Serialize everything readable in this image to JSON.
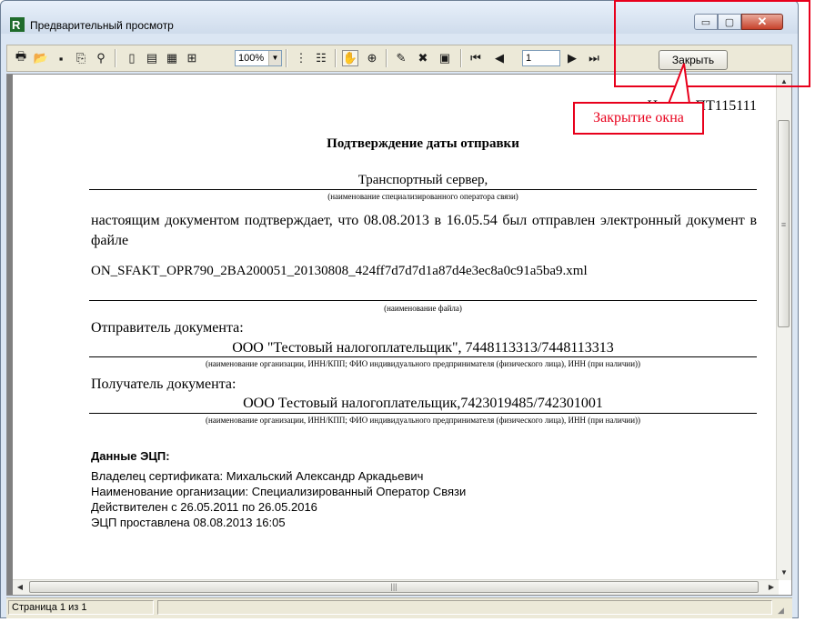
{
  "window": {
    "title": "Предварительный просмотр"
  },
  "window_controls": {
    "minimize": "▭",
    "maximize": "▢",
    "close": "✕"
  },
  "toolbar": {
    "zoom_value": "100%",
    "page_value": "1",
    "close_label": "Закрыть",
    "icons": [
      "print-icon",
      "open-icon",
      "save-icon",
      "export-icon",
      "find-icon",
      "page-view-icon",
      "page-width-icon",
      "two-pages-icon",
      "four-pages-icon",
      "outline-icon",
      "tree-icon",
      "hand-icon",
      "zoom-icon",
      "edit-icon",
      "delete-page-icon",
      "properties-icon",
      "first-page-icon",
      "prev-page-icon",
      "next-page-icon",
      "last-page-icon"
    ]
  },
  "document": {
    "number_partial": "Номер: ПТ115111",
    "title": "Подтверждение даты отправки",
    "operator": "Транспортный сервер,",
    "operator_caption": "(наименование специализированного оператора связи)",
    "body_text": "настоящим документом подтверждает, что 08.08.2013 в 16.05.54 был отправлен электронный документ в файле",
    "filename": "ON_SFAKT_OPR790_2BA200051_20130808_424ff7d7d7d1a87d4e3ec8a0c91a5ba9.xml",
    "filename_caption": "(наименование файла)",
    "sender_label": "Отправитель документа:",
    "sender_value": "ООО \"Тестовый налогоплательщик\", 7448113313/7448113313",
    "sender_caption": "(наименование организации, ИНН/КПП;  ФИО индивидуального предпринимателя (физического лица), ИНН (при наличии))",
    "recipient_label": "Получатель документа:",
    "recipient_value": "ООО Тестовый налогоплательщик,7423019485/742301001",
    "recipient_caption": "(наименование организации, ИНН/КПП;  ФИО индивидуального предпринимателя (физического лица), ИНН (при наличии))",
    "signature": {
      "heading": "Данные ЭЦП:",
      "owner": "Владелец сертификата: Михальский Александр Аркадьевич",
      "org": "Наименование организации: Специализированный Оператор Связи",
      "valid": "Действителен с 26.05.2011 по 26.05.2016",
      "signed": "ЭЦП проставлена 08.08.2013 16:05"
    }
  },
  "statusbar": {
    "page_info": "Страница 1 из 1"
  },
  "annotation": {
    "callout_text": "Закрытие окна",
    "color": "#e8001c"
  }
}
